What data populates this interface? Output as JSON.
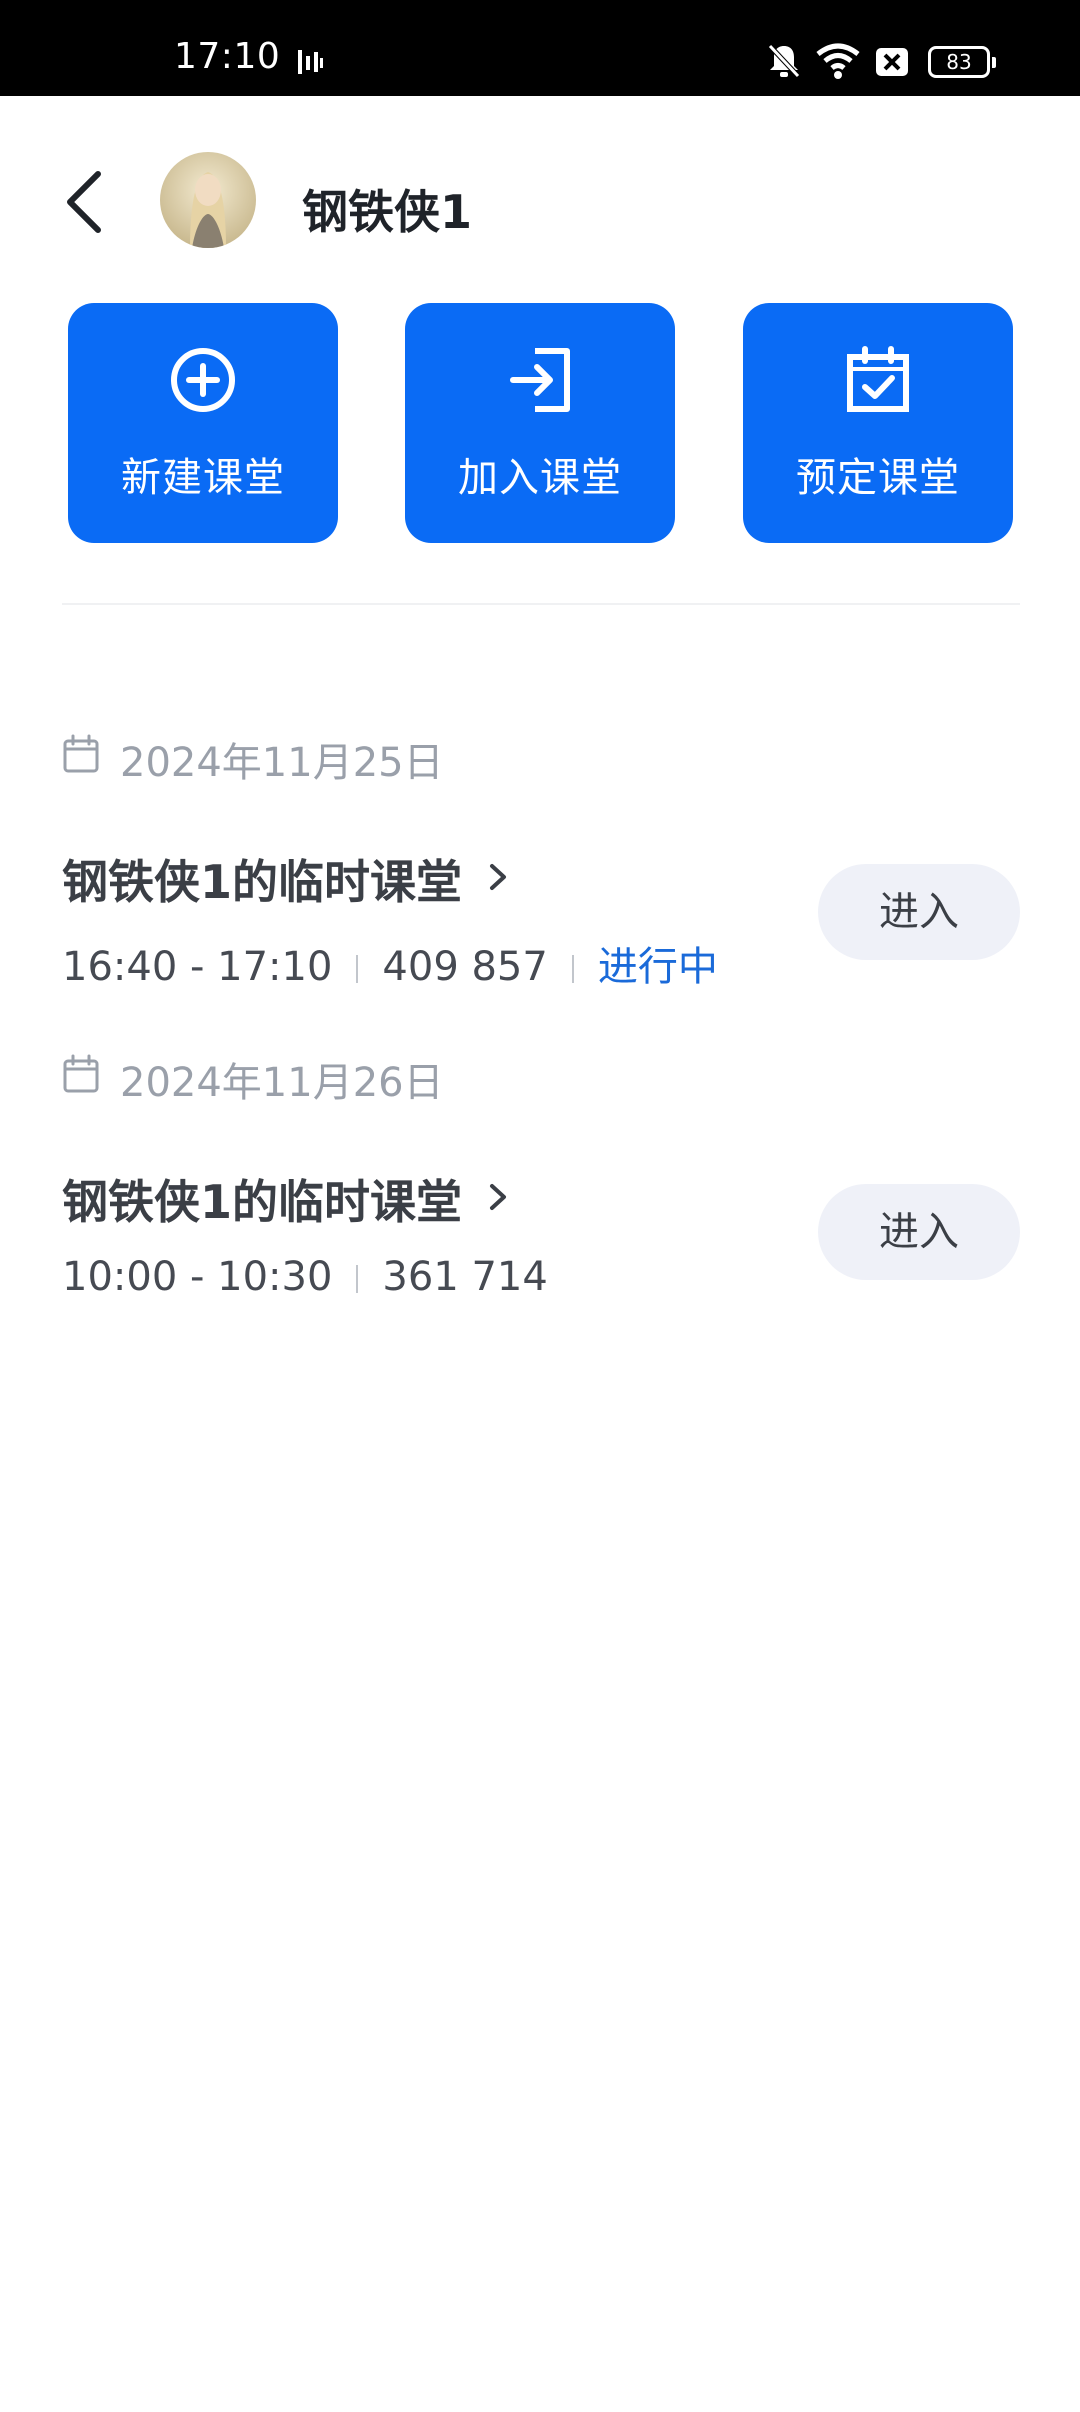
{
  "status_bar": {
    "time": "17:10",
    "battery": "83"
  },
  "header": {
    "user_name": "钢铁侠1"
  },
  "actions": [
    {
      "label": "新建课堂",
      "icon": "plus-circle-icon"
    },
    {
      "label": "加入课堂",
      "icon": "login-icon"
    },
    {
      "label": "预定课堂",
      "icon": "calendar-check-icon"
    }
  ],
  "schedule": [
    {
      "date": "2024年11月25日",
      "meeting": {
        "title": "钢铁侠1的临时课堂",
        "time": "16:40 - 17:10",
        "meeting_id": "409 857",
        "status": "进行中",
        "enter_label": "进入"
      }
    },
    {
      "date": "2024年11月26日",
      "meeting": {
        "title": "钢铁侠1的临时课堂",
        "time": "10:00 - 10:30",
        "meeting_id": "361 714",
        "enter_label": "进入"
      }
    }
  ],
  "colors": {
    "primary": "#0a6bf5",
    "status_active": "#1a6ad9",
    "enter_button_bg": "#eff1f8"
  }
}
